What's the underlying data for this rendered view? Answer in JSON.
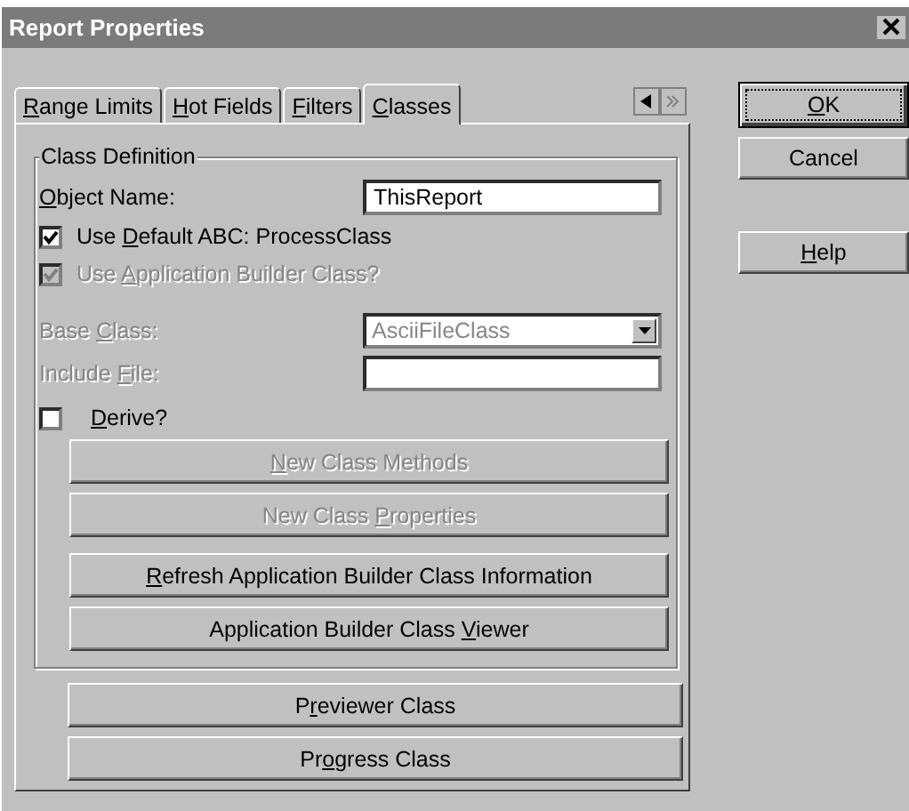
{
  "window": {
    "title": "Report Properties"
  },
  "tabs": [
    {
      "label": {
        "key": "R",
        "post": "ange Limits"
      },
      "selected": false
    },
    {
      "label": {
        "key": "H",
        "post": "ot Fields"
      },
      "selected": false
    },
    {
      "label": {
        "key": "F",
        "post": "ilters"
      },
      "selected": false
    },
    {
      "label": {
        "key": "C",
        "post": "lasses"
      },
      "selected": true
    }
  ],
  "group": {
    "title": "Class Definition",
    "object_name": {
      "label": {
        "key": "O",
        "post": "bject Name:"
      },
      "value": "ThisReport"
    },
    "checkboxes": [
      {
        "label": {
          "pre": "Use ",
          "key": "D",
          "post": "efault ABC: ProcessClass"
        },
        "checked": true,
        "disabled": false
      },
      {
        "label": {
          "pre": "Use ",
          "key": "A",
          "post": "pplication Builder Class?"
        },
        "checked": true,
        "disabled": true
      }
    ],
    "base_class": {
      "label": {
        "pre": "Base ",
        "key": "C",
        "post": "lass:"
      },
      "value": "AsciiFileClass",
      "disabled": true
    },
    "include_file": {
      "label": {
        "pre": "Include ",
        "key": "F",
        "post": "ile:"
      },
      "disabled": true
    },
    "derive": {
      "label": {
        "key": "D",
        "post": "erive?"
      },
      "checked": false,
      "disabled": false
    },
    "buttons": [
      {
        "label": {
          "key": "N",
          "post": "ew Class Methods"
        },
        "disabled": true
      },
      {
        "label": {
          "pre": "New Class ",
          "key": "P",
          "post": "roperties"
        },
        "disabled": true
      },
      {
        "label": {
          "key": "R",
          "post": "efresh Application Builder Class Information"
        },
        "disabled": false
      },
      {
        "label": {
          "pre": "Application Builder Class ",
          "key": "V",
          "post": "iewer"
        },
        "disabled": false
      }
    ]
  },
  "panel_buttons": [
    {
      "label": {
        "pre": "P",
        "key": "r",
        "post": "eviewer Class"
      },
      "disabled": false
    },
    {
      "label": {
        "pre": "Pr",
        "key": "o",
        "post": "gress Class"
      },
      "disabled": false
    }
  ],
  "side_buttons": [
    {
      "label": {
        "key": "O",
        "post": "K"
      },
      "default": true
    },
    {
      "label": {
        "post": "Cancel"
      },
      "default": false
    },
    {
      "label": {
        "key": "H",
        "post": "elp"
      },
      "default": false
    }
  ]
}
